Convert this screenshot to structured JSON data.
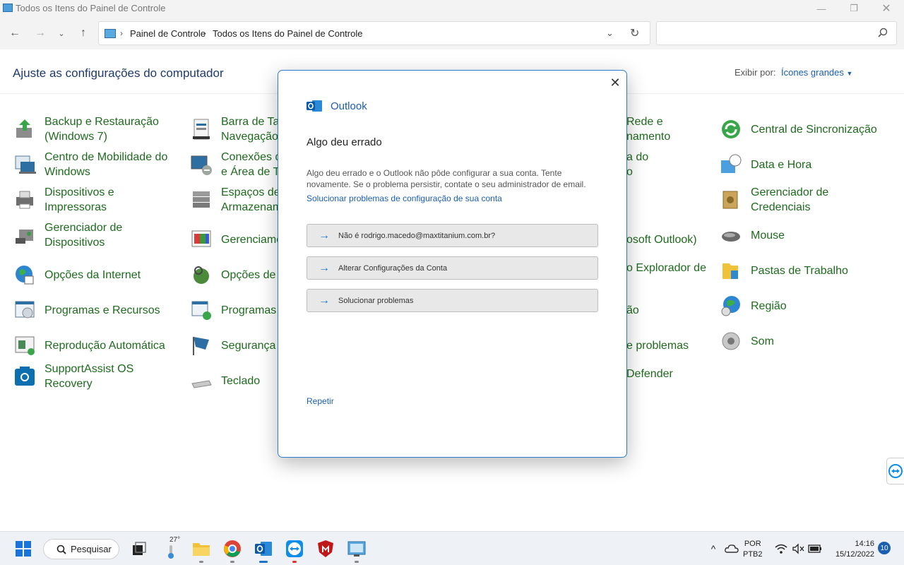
{
  "window": {
    "title": "Todos os Itens do Painel de Controle",
    "minimize_icon": "minimize-icon",
    "maximize_icon": "restore-icon",
    "close_icon": "close-icon"
  },
  "nav": {
    "breadcrumb": [
      "Painel de Controle",
      "Todos os Itens do Painel de Controle"
    ],
    "search_placeholder": ""
  },
  "header": {
    "title": "Ajuste as configurações do computador",
    "view_by_label": "Exibir por:",
    "view_by_value": "Ícones grandes"
  },
  "items": [
    {
      "label1": "Backup e Restauração",
      "label2": "(Windows 7)",
      "icon": "backup-icon"
    },
    {
      "label1": "Centro de Mobilidade do",
      "label2": "Windows",
      "icon": "mobility-center-icon"
    },
    {
      "label1": "Dispositivos e",
      "label2": "Impressoras",
      "icon": "printer-icon"
    },
    {
      "label1": "Gerenciador de",
      "label2": "Dispositivos",
      "icon": "device-manager-icon"
    },
    {
      "label1": "Opções da Internet",
      "label2": "",
      "icon": "internet-options-icon"
    },
    {
      "label1": "Programas e Recursos",
      "label2": "",
      "icon": "programs-icon"
    },
    {
      "label1": "Reprodução Automática",
      "label2": "",
      "icon": "autoplay-icon"
    },
    {
      "label1": "SupportAssist OS",
      "label2": "Recovery",
      "icon": "supportassist-icon"
    },
    {
      "label1": "Barra de Ta",
      "label2": "Navegação",
      "icon": "taskbar-icon"
    },
    {
      "label1": "Conexões d",
      "label2": "e Área de T",
      "icon": "remote-desktop-icon"
    },
    {
      "label1": "Espaços de",
      "label2": "Armazenam",
      "icon": "storage-spaces-icon"
    },
    {
      "label1": "Gerenciame",
      "label2": "",
      "icon": "color-management-icon"
    },
    {
      "label1": "Opções de",
      "label2": "",
      "icon": "indexing-options-icon"
    },
    {
      "label1": "Programas",
      "label2": "",
      "icon": "default-programs-icon"
    },
    {
      "label1": "Segurança",
      "label2": "",
      "icon": "security-flag-icon"
    },
    {
      "label1": "Teclado",
      "label2": "",
      "icon": "keyboard-icon"
    },
    {
      "label1": "Rede e",
      "label2": "namento",
      "icon": ""
    },
    {
      "label1": "a do",
      "label2": "o",
      "icon": ""
    },
    {
      "label1": "osoft Outlook)",
      "label2": "",
      "icon": ""
    },
    {
      "label1": "o Explorador de",
      "label2": "",
      "icon": ""
    },
    {
      "label1": "ão",
      "label2": "",
      "icon": ""
    },
    {
      "label1": "e problemas",
      "label2": "",
      "icon": ""
    },
    {
      "label1": "Defender",
      "label2": "",
      "icon": ""
    },
    {
      "label1": "Central de Sincronização",
      "label2": "",
      "icon": "sync-center-icon"
    },
    {
      "label1": "Data e Hora",
      "label2": "",
      "icon": "date-time-icon"
    },
    {
      "label1": "Gerenciador de",
      "label2": "Credenciais",
      "icon": "credential-manager-icon"
    },
    {
      "label1": "Mouse",
      "label2": "",
      "icon": "mouse-icon"
    },
    {
      "label1": "Pastas de Trabalho",
      "label2": "",
      "icon": "work-folders-icon"
    },
    {
      "label1": "Região",
      "label2": "",
      "icon": "region-globe-icon"
    },
    {
      "label1": "Som",
      "label2": "",
      "icon": "speaker-icon"
    }
  ],
  "dialog": {
    "brand": "Outlook",
    "title": "Algo deu errado",
    "message": "Algo deu errado e o Outlook não pôde configurar a sua conta. Tente novamente. Se o problema persistir, contate o seu administrador de email.",
    "help_link": "Solucionar problemas de configuração de sua conta",
    "options": [
      "Não é rodrigo.macedo@maxtitanium.com.br?",
      "Alterar Configurações da Conta",
      "Solucionar problemas"
    ],
    "retry": "Repetir"
  },
  "taskbar": {
    "search_label": "Pesquisar",
    "temperature": "27°",
    "language_top": "POR",
    "language_bottom": "PTB2",
    "time": "14:16",
    "date": "15/12/2022",
    "notifications": "10"
  }
}
